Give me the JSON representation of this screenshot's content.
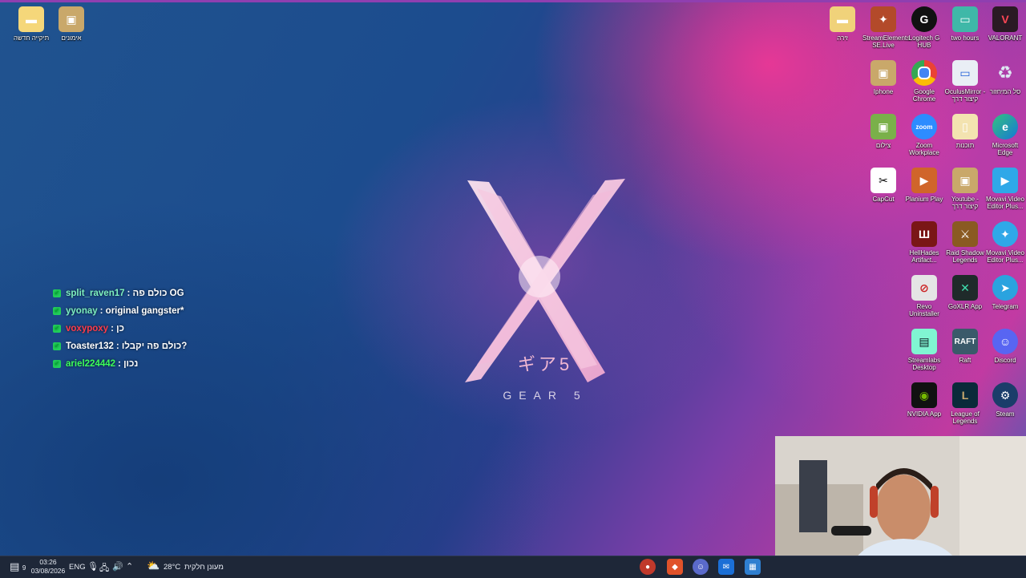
{
  "desktop_left": [
    {
      "label": "תיקייה חדשה",
      "icon": "folder-icon"
    },
    {
      "label": "אימונים",
      "icon": "folder-image-icon"
    }
  ],
  "desktop_right": [
    {
      "label": "זירה",
      "icon": "folder-icon"
    },
    {
      "label": "StreamElements SE.Live",
      "icon": "streamelements-icon"
    },
    {
      "label": "Logitech G HUB",
      "icon": "logitech-icon"
    },
    {
      "label": "two hours",
      "icon": "image-file-icon"
    },
    {
      "label": "VALORANT",
      "icon": "valorant-icon"
    },
    {
      "label": "Iphone",
      "icon": "folder-image-icon"
    },
    {
      "label": "Google Chrome",
      "icon": "chrome-icon"
    },
    {
      "label": "OculusMirror - קיצור דרך",
      "icon": "oculus-icon"
    },
    {
      "label": "סל המיחזור",
      "icon": "recycle-bin-icon"
    },
    {
      "label": "צילום",
      "icon": "folder-image-icon"
    },
    {
      "label": "Zoom Workplace",
      "icon": "zoom-icon"
    },
    {
      "label": "תוכנות",
      "icon": "folder-icon"
    },
    {
      "label": "Microsoft Edge",
      "icon": "edge-icon"
    },
    {
      "label": "CapCut",
      "icon": "capcut-icon"
    },
    {
      "label": "Planium Play",
      "icon": "planium-icon"
    },
    {
      "label": "Youtube - קיצור דרך",
      "icon": "folder-image-icon"
    },
    {
      "label": "Movavi Video Editor Plus...",
      "icon": "movavi-icon"
    },
    {
      "label": "HellHades Artifact...",
      "icon": "hellhades-icon"
    },
    {
      "label": "Raid Shadow Legends",
      "icon": "raid-icon"
    },
    {
      "label": "Movavi Video Editor Plus...",
      "icon": "movavi-icon"
    },
    {
      "label": "Revo Uninstaller",
      "icon": "revo-icon"
    },
    {
      "label": "GoXLR App",
      "icon": "goxlr-icon"
    },
    {
      "label": "Telegram",
      "icon": "telegram-icon"
    },
    {
      "label": "Streamlabs Desktop",
      "icon": "streamlabs-icon"
    },
    {
      "label": "Raft",
      "icon": "raft-icon"
    },
    {
      "label": "Discord",
      "icon": "discord-icon"
    },
    {
      "label": "NVIDIA App",
      "icon": "nvidia-icon"
    },
    {
      "label": "League of Legends",
      "icon": "league-icon"
    },
    {
      "label": "Steam",
      "icon": "steam-icon"
    }
  ],
  "wallpaper": {
    "logo_jp": "ギア5",
    "logo_text": "GEAR 5"
  },
  "chat": [
    {
      "user": "split_raven17",
      "user_color": "#7ef0c0",
      "message": "כולם פה OG"
    },
    {
      "user": "yyonay",
      "user_color": "#7ef0c0",
      "message": "original gangster*"
    },
    {
      "user": "voxypoxy",
      "user_color": "#ff3b4a",
      "message": "כן"
    },
    {
      "user": "Toaster132",
      "user_color": "#ffffff",
      "message": "כולם פה יקבלו?"
    },
    {
      "user": "ariel224442",
      "user_color": "#3cff5a",
      "message": "נכון"
    }
  ],
  "taskbar": {
    "time": "03:26",
    "date": "03/08/2026",
    "language": "ENG",
    "temperature": "28°C",
    "weather": "מעונן חלקית",
    "notification_count": "9"
  }
}
